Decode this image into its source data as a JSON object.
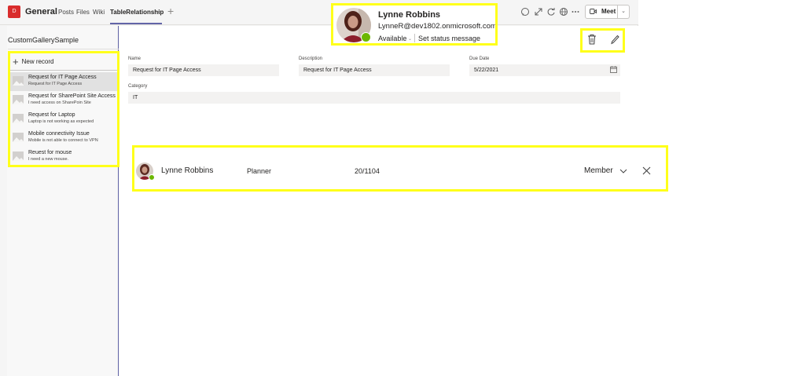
{
  "header": {
    "team_initial": "D",
    "channel": "General",
    "tabs": [
      {
        "label": "Posts"
      },
      {
        "label": "Files"
      },
      {
        "label": "Wiki"
      },
      {
        "label": "TableRelationship"
      }
    ],
    "meet_label": "Meet"
  },
  "gallery": {
    "title": "CustomGallerySample",
    "new_record_label": "New record",
    "items": [
      {
        "title": "Request for IT Page Access",
        "subtitle": "Request for IT Page Access"
      },
      {
        "title": "Request for SharePoint Site Access",
        "subtitle": "I need access on SharePoin Site"
      },
      {
        "title": "Request for Laptop",
        "subtitle": "Laptop is not working as expected"
      },
      {
        "title": "Mobile connectivity Issue",
        "subtitle": "Mobile is not able to connect to VPN"
      },
      {
        "title": "Reuest for mouse",
        "subtitle": "I need a new mouse."
      }
    ]
  },
  "form": {
    "name_label": "Name",
    "name_value": "Request for IT Page Access",
    "description_label": "Description",
    "description_value": "Request for IT Page Access",
    "due_date_label": "Due Date",
    "due_date_value": "5/22/2021",
    "category_label": "Category",
    "category_value": "IT"
  },
  "member_row": {
    "name": "Lynne Robbins",
    "department": "Planner",
    "code": "20/1104",
    "role": "Member"
  },
  "profile_card": {
    "name": "Lynne Robbins",
    "email": "LynneR@dev1802.onmicrosoft.com",
    "status": "Available",
    "set_status_label": "Set status message"
  },
  "colors": {
    "accent": "#6264a7",
    "highlight": "#ffff1a",
    "presence": "#6bb700",
    "team_avatar": "#d92c2c"
  }
}
